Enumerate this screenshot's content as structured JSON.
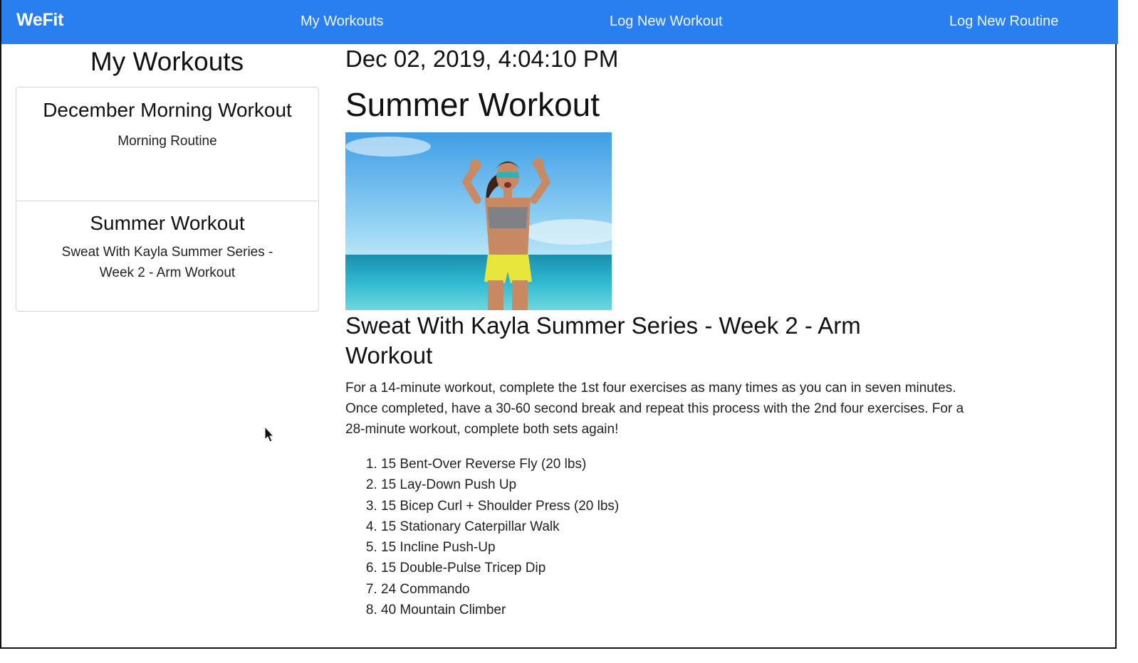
{
  "navbar": {
    "brand": "WeFit",
    "links": [
      "My Workouts",
      "Log New Workout",
      "Log New Routine"
    ],
    "color": "#2a7ff0"
  },
  "sidebar": {
    "title": "My Workouts",
    "workouts": [
      {
        "name": "December Morning Workout",
        "routine": "Morning Routine"
      },
      {
        "name": "Summer Workout",
        "routine": "Sweat With Kayla Summer Series - Week 2 - Arm Workout"
      }
    ]
  },
  "detail": {
    "date": "Dec 02, 2019, 4:04:10 PM",
    "title": "Summer Workout",
    "routine_name": "Sweat With Kayla Summer Series - Week 2 - Arm Workout",
    "description": "For a 14-minute workout, complete the 1st four exercises as many times as you can in seven minutes. Once completed, have a 30-60 second break and repeat this process with the 2nd four exercises. For a 28-minute workout, complete both sets again!",
    "exercises": [
      "15 Bent-Over Reverse Fly (20 lbs)",
      "15 Lay-Down Push Up",
      "15 Bicep Curl + Shoulder Press (20 lbs)",
      "15 Stationary Caterpillar Walk",
      "15 Incline Push-Up",
      "15 Double-Pulse Tricep Dip",
      "24 Commando",
      "40 Mountain Climber"
    ]
  }
}
